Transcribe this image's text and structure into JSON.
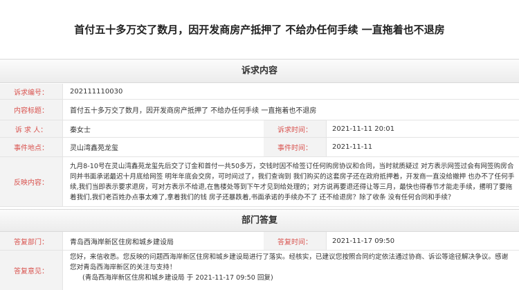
{
  "title": "首付五十多万交了数月，因开发商房产抵押了 不给办任何手续 一直拖着也不退房",
  "sections": {
    "complaint": "诉求内容",
    "reply": "部门答复"
  },
  "complaint": {
    "id_label": "诉求编号：",
    "id_value": "202111110030",
    "topic_label": "内容标题：",
    "topic_value": "首付五十多万交了数月，因开发商房产抵押了 不给办任何手续 一直拖着也不退房",
    "person_label": "诉 求 人：",
    "person_value": "秦女士",
    "time_label": "诉求时间：",
    "time_value": "2021-11-11 20:01",
    "place_label": "事件地点：",
    "place_value": "灵山湾鑫苑龙玺",
    "event_time_label": "事件时间：",
    "event_time_value": "2021-11-11",
    "feedback_label": "反映内容：",
    "feedback_value": "九月8-10号在灵山湾鑫苑龙玺先后交了订金和首付一共50多万，交钱时因不给签订任何购房协议和合同，当时就质疑过 对方表示网签过会有网签购房合同并书面承诺最迟十月底给网签 明年年底会交房，可时间过了，我们查询到 我们购买的这套房子还在政府抵押着，开发商一直没给撤押 也办不了任何手续,我们当即表示要求退房，可对方表示不给退,在售楼处等到下午才见到给处理的；对方说再要退还得让等三月，最快也得春节才能走手续，撂明了要拖着我们,我们老百姓办点事太难了,拿着我们的钱 房子还暴跌着,书面承诺的手续办不了 还不给退房？除了收条 没有任何合同和手续？"
  },
  "reply": {
    "dept_label": "答复部门：",
    "dept_value": "青岛西海岸新区住房和城乡建设局",
    "reply_time_label": "答复时间：",
    "reply_time_value": "2021-11-17 09:50",
    "opinion_label": "答复意见：",
    "opinion_value": "您好，来信收悉。您反映的问题西海岸新区住房和城乡建设局进行了落实。经核实，已建议您按照合同约定依法通过协商、诉讼等途径解决争议。感谢您对青岛西海岸新区的关注与支持！",
    "signature": "(青岛西海岸新区住房和城乡建设局 于 2021-11-17 09:50 回复)"
  }
}
